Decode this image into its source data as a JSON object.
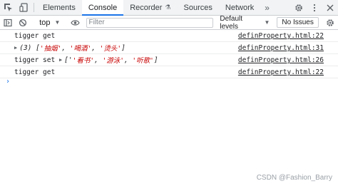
{
  "tabbar": {
    "tabs": [
      {
        "label": "Elements",
        "active": false
      },
      {
        "label": "Console",
        "active": true
      },
      {
        "label": "Recorder",
        "active": false
      },
      {
        "label": "Sources",
        "active": false
      },
      {
        "label": "Network",
        "active": false
      }
    ],
    "overflow_label": "»"
  },
  "toolbar": {
    "context_label": "top",
    "filter_placeholder": "Filter",
    "levels_label": "Default levels",
    "issues_label": "No Issues"
  },
  "console": {
    "messages": [
      {
        "text": "tigger get",
        "source": "definProperty.html:22"
      },
      {
        "array_count": "(3)",
        "array_open": "[",
        "items": [
          "'抽烟'",
          "'喝酒'",
          "'烫头'"
        ],
        "array_close": "]",
        "source": "definProperty.html:31"
      },
      {
        "prefix": "tigger set",
        "array_open": "['",
        "items": [
          "'看书'",
          "'游泳'",
          "'听歌'"
        ],
        "array_close": "]",
        "source": "definProperty.html:26"
      },
      {
        "text": "tigger get",
        "source": "definProperty.html:22"
      }
    ],
    "prompt": "›"
  },
  "watermark": "CSDN @Fashion_Barry",
  "colors": {
    "accent": "#1a73e8",
    "string": "#c80000",
    "border": "#cacdd1"
  }
}
